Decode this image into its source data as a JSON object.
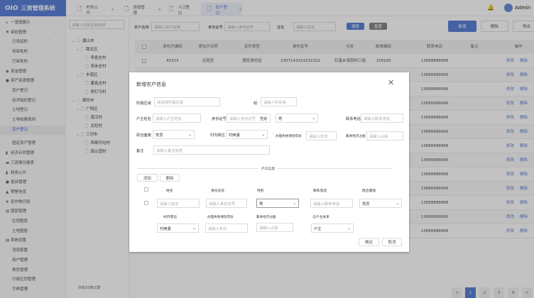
{
  "app": {
    "title": "三资管理系统",
    "logo": "OIO",
    "user": "Admin"
  },
  "colors": {
    "accent": "#5b82d8",
    "overlay": "rgba(0,0,0,0.24)"
  },
  "sidebar": {
    "items": [
      {
        "label": "一张图展示",
        "icon": "home-icon",
        "level": 0
      },
      {
        "label": "审批管理",
        "icon": "approval-icon",
        "level": 0,
        "expandable": true
      },
      {
        "label": "已发起的",
        "level": 1
      },
      {
        "label": "待审批的",
        "level": 1
      },
      {
        "label": "已审批的",
        "level": 1
      },
      {
        "label": "资金管理",
        "icon": "fund-icon",
        "level": 0,
        "expandable": true
      },
      {
        "label": "资产资源管理",
        "icon": "asset-icon",
        "level": 0,
        "expandable": true
      },
      {
        "label": "农户登记",
        "level": 1
      },
      {
        "label": "经济组织登记",
        "level": 1
      },
      {
        "label": "土地登记",
        "level": 1
      },
      {
        "label": "土地收费规则",
        "level": 1
      },
      {
        "label": "农户登记",
        "level": 1,
        "active": true
      },
      {
        "label": "固定资产管理",
        "level": 1
      },
      {
        "label": "经济合同管理",
        "icon": "contract-icon",
        "level": 0
      },
      {
        "label": "三资情况报表",
        "icon": "report-icon",
        "level": 0
      },
      {
        "label": "政务公开",
        "icon": "notice-icon",
        "level": 0
      },
      {
        "label": "投诉管理",
        "icon": "complaint-icon",
        "level": 0
      },
      {
        "label": "预警信息",
        "icon": "warning-icon",
        "level": 0
      },
      {
        "label": "农作物识别",
        "icon": "leaf-icon",
        "level": 0
      },
      {
        "label": "图层管理",
        "icon": "layer-icon",
        "level": 0,
        "expandable": true
      },
      {
        "label": "区划图层",
        "level": 1
      },
      {
        "label": "土地图层",
        "level": 1
      },
      {
        "label": "系统设置",
        "icon": "settings-icon",
        "level": 0,
        "expandable": true
      },
      {
        "label": "消息配置",
        "level": 1
      },
      {
        "label": "用户管理",
        "level": 1
      },
      {
        "label": "角色管理",
        "level": 1
      },
      {
        "label": "行政区划管理",
        "level": 1
      },
      {
        "label": "字典管理",
        "level": 1
      }
    ]
  },
  "tabs": [
    {
      "label": "村务公开"
    },
    {
      "label": "党组管理"
    },
    {
      "label": "人口登记"
    },
    {
      "label": "农户登记",
      "active": true
    }
  ],
  "tree": {
    "search_placeholder": "请输入行政区划名称",
    "nodes": [
      {
        "label": "唐山市",
        "depth": 0
      },
      {
        "label": "路北区",
        "depth": 1
      },
      {
        "label": "李各庄村",
        "depth": 2
      },
      {
        "label": "宋禾庄村",
        "depth": 2
      },
      {
        "label": "丰南区",
        "depth": 1
      },
      {
        "label": "董各庄村",
        "depth": 2
      },
      {
        "label": "胡打马村",
        "depth": 2
      },
      {
        "label": "廊坊市",
        "depth": 0
      },
      {
        "label": "广阳区",
        "depth": 1
      },
      {
        "label": "南汉村",
        "depth": 2
      },
      {
        "label": "北旺村",
        "depth": 2
      },
      {
        "label": "三河市",
        "depth": 1
      },
      {
        "label": "西柳河屯村",
        "depth": 2
      },
      {
        "label": "孤山营村",
        "depth": 2
      }
    ]
  },
  "search": {
    "name_label": "农户名称",
    "name_placeholder": "请输入农户名称",
    "id_label": "身份证号",
    "id_placeholder": "请输入身份证号",
    "addr_label": "住址",
    "addr_placeholder": "请输入住址",
    "search": "搜索",
    "reset": "重置"
  },
  "toolbar": {
    "add": "新增",
    "delete": "删除",
    "export": "导出"
  },
  "table": {
    "headers": [
      "承包方编码",
      "承包方名称",
      "证件类型",
      "身份证号",
      "住址",
      "邮政编码",
      "联系电话",
      "备注",
      "操作"
    ],
    "first_row": [
      "45315",
      "吕冠至",
      "居民身份证",
      "2307143324232322",
      "红星乡张院村三组",
      "158100"
    ],
    "phones": [
      "13888888888",
      "13666666666",
      "13888888888",
      "13666666666",
      "13888888888",
      "13666666666",
      "13888888888",
      "13666666666",
      "13888888888",
      "13666666666",
      "13888888888",
      "13666666666",
      "13888888888"
    ],
    "edit": "修改",
    "delete": "删除"
  },
  "footer": {
    "total": "共有10条记录"
  },
  "pagination": {
    "prev": "<",
    "pages": [
      "1",
      "2",
      "3",
      "4"
    ],
    "current": 1,
    "next": ">"
  },
  "modal": {
    "title": "新增农户信息",
    "region_label": "所属区域",
    "region_placeholder": "请选择所属区域",
    "group_label": "组",
    "group_placeholder": "请输入所在组",
    "owner_label": "户主姓名",
    "owner_placeholder": "请输入户主姓名",
    "id_label": "身份证号",
    "id_placeholder": "请输入身份证号",
    "gender_label": "性别",
    "gender_value": "男",
    "phone_label": "联系电话",
    "phone_placeholder": "请输入联系电话",
    "politics_label": "政治面貌",
    "politics_value": "党员",
    "post_label": "村内岗位",
    "post_value": "村两委",
    "insurance_label": "办理失地保险年份",
    "insurance_placeholder": "请输入年份",
    "share_label": "集体经济占股",
    "share_placeholder": "请输入占股",
    "remark_label": "备注",
    "remark_placeholder": "请输入备注信息",
    "divider": "户口信息",
    "add": "添加",
    "delete": "删除",
    "members": {
      "headers": [
        "姓名",
        "身份证号",
        "性别",
        "联系电话",
        "政治面貌"
      ],
      "name_placeholder": "请输入姓名",
      "id_placeholder": "请输入身份证号",
      "gender": "男",
      "phone_placeholder": "请输入联系电话",
      "politics": "党员",
      "headers2": [
        "村内岗位",
        "办理失地保险年份",
        "集体经济占股",
        "与户主关系"
      ],
      "post": "村两委",
      "year_placeholder": "请输入年份",
      "share_placeholder": "请输入占股",
      "relation": "户主"
    },
    "ok": "确定",
    "cancel": "取消"
  }
}
